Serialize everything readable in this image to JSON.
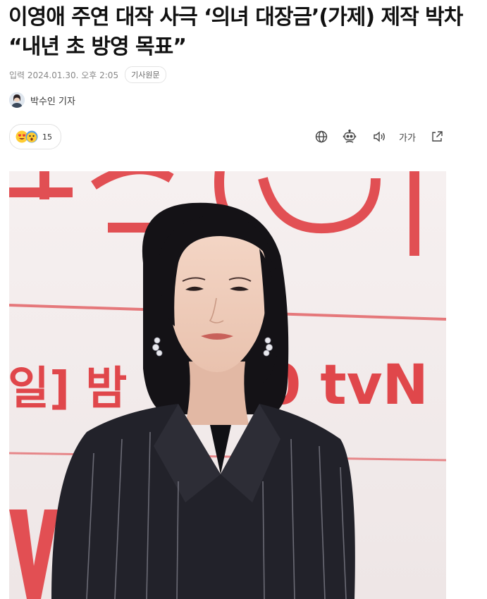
{
  "article": {
    "headline": "이영애 주연 대작 사극 ‘의녀 대장금’(가제) 제작 박차 “내년 초 방영 목표”",
    "published": "입력 2024.01.30. 오후 2:05",
    "original_button": "기사원문",
    "reporter": "박수인 기자"
  },
  "reactions": {
    "count": "15",
    "emojis": [
      "heart-eyes-emoji",
      "surprised-emoji"
    ]
  },
  "toolbar": {
    "items": [
      "globe-icon",
      "robot-summary-icon",
      "speaker-icon",
      "font-size-icon",
      "share-icon"
    ],
    "font_size_label": "가가"
  },
  "photo": {
    "backdrop_text_1": "일] 밤",
    "backdrop_text_2": "0 tvN"
  },
  "colors": {
    "backdrop_red": "#e0474b",
    "jacket": "#22222a",
    "hair": "#141216"
  }
}
